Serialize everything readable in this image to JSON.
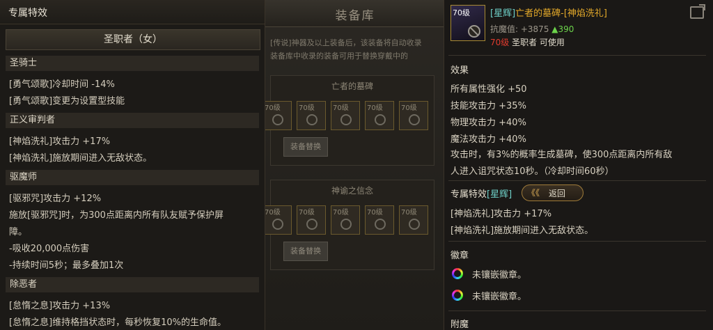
{
  "colors": {
    "accent_gold": "#e3a92a",
    "tag_cyan": "#6fd0c8",
    "stat_green": "#6cd44b",
    "level_red": "#e03b2e"
  },
  "background_window": {
    "title": "装备库",
    "notice_lines": [
      "[传说]神器及以上装备后，该装备将自动收录",
      "装备库中收录的装备可用于替换穿戴中的"
    ],
    "sets": [
      {
        "title": "亡者的墓碑",
        "slot_label": "70级",
        "slots": 5,
        "button": "装备替换"
      },
      {
        "title": "神谕之信念",
        "slot_label": "70级",
        "slots": 5,
        "button": "装备替换"
      }
    ]
  },
  "left_panel": {
    "title": "专属特效",
    "class_name": "圣职者（女）",
    "sections": [
      {
        "name": "圣骑士",
        "lines": [
          "[勇气颂歌]冷却时间 -14%",
          "[勇气颂歌]变更为设置型技能"
        ]
      },
      {
        "name": "正义审判者",
        "lines": [
          "[神焰洗礼]攻击力 +17%",
          "[神焰洗礼]施放期间进入无敌状态。"
        ]
      },
      {
        "name": "驱魔师",
        "lines": [
          "[驱邪咒]攻击力 +12%",
          "施放[驱邪咒]时，为300点距离内所有队友赋予保护屏",
          "障。",
          "-吸收20,000点伤害",
          "-持续时间5秒；最多叠加1次"
        ]
      },
      {
        "name": "除恶者",
        "lines": [
          "[怠惰之息]攻击力 +13%",
          "[怠惰之息]维持格挡状态时，每秒恢复10%的生命值。"
        ]
      }
    ]
  },
  "item": {
    "level_badge": "70级",
    "tag": "[星辉]",
    "name": "亡者的墓碑-[神焰洗礼]",
    "resist_label": "抗魔值: +3875",
    "resist_increase": "▲390",
    "req_level": "70级",
    "req_class": "圣职者 可使用",
    "effects_title": "效果",
    "effects": [
      "所有属性强化 +50",
      "技能攻击力 +35%",
      "物理攻击力 +40%",
      "魔法攻击力 +40%",
      "攻击时，有3%的概率生成墓碑，使300点距离内所有敌",
      "人进入诅咒状态10秒。（冷却时间60秒）"
    ],
    "exclusive_title": "专属特效",
    "exclusive_tag": "[星辉]",
    "back_chevron": "《《",
    "back_label": "返回",
    "exclusive_lines": [
      "[神焰洗礼]攻击力 +17%",
      "[神焰洗礼]施放期间进入无敌状态。"
    ],
    "emblem_title": "徽章",
    "emblems": [
      "未镶嵌徽章。",
      "未镶嵌徽章。"
    ],
    "enchant_title": "附魔"
  }
}
